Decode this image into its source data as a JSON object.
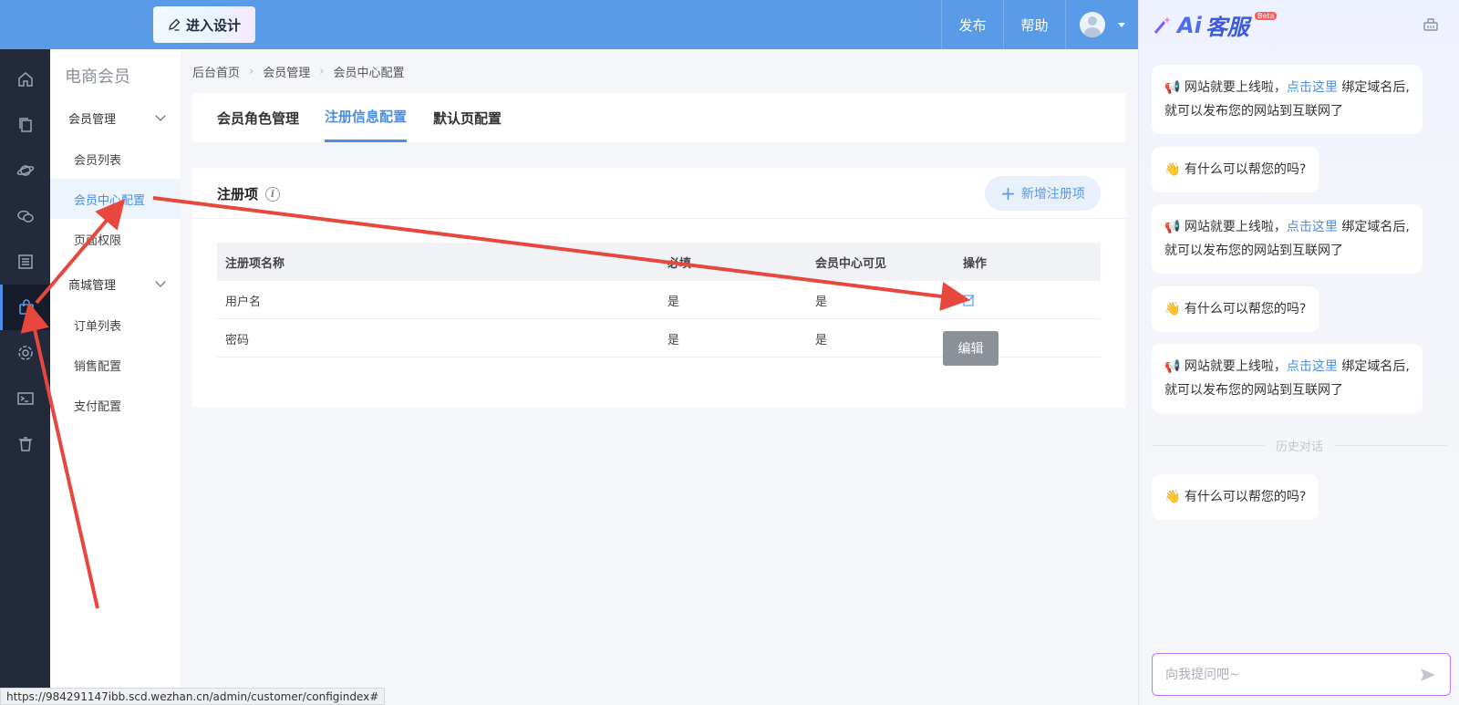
{
  "topbar": {
    "design_button": "进入设计",
    "publish": "发布",
    "help": "帮助"
  },
  "rail": {
    "items": [
      "home-icon",
      "copy-icon",
      "planet-icon",
      "chat-icon",
      "list-icon",
      "bag-icon",
      "gear-icon",
      "terminal-icon",
      "trash-icon"
    ],
    "active_index": 5
  },
  "subnav": {
    "title": "电商会员",
    "group_member": "会员管理",
    "member_list": "会员列表",
    "member_center_config": "会员中心配置",
    "page_permission": "页面权限",
    "group_mall": "商城管理",
    "order_list": "订单列表",
    "sales_config": "销售配置",
    "payment_config": "支付配置"
  },
  "breadcrumb": {
    "home": "后台首页",
    "member_mgmt": "会员管理",
    "current": "会员中心配置"
  },
  "tabs": {
    "role": "会员角色管理",
    "register": "注册信息配置",
    "default_page": "默认页配置"
  },
  "card": {
    "title": "注册项",
    "add_button": "新增注册项"
  },
  "table": {
    "headers": [
      "注册项名称",
      "必填",
      "会员中心可见",
      "操作"
    ],
    "rows": [
      {
        "name": "用户名",
        "required": "是",
        "visible": "是"
      },
      {
        "name": "密码",
        "required": "是",
        "visible": "是"
      }
    ]
  },
  "tooltip": {
    "edit": "编辑"
  },
  "status_url": "https://984291147ibb.scd.wezhan.cn/admin/customer/configindex#",
  "ai": {
    "logo_text": "客服",
    "beta": "Beta",
    "msg_online_prefix": "网站就要上线啦，",
    "msg_online_link": "点击这里",
    "msg_online_suffix": "绑定域名后,就可以发布您的网站到互联网了",
    "msg_help": "有什么可以帮您的吗?",
    "history_label": "历史对话",
    "input_placeholder": "向我提问吧~"
  },
  "colors": {
    "topbar": "#5a9be8",
    "accent": "#4a8fe5",
    "rail": "#232a3b",
    "arrow": "#e8473e"
  }
}
